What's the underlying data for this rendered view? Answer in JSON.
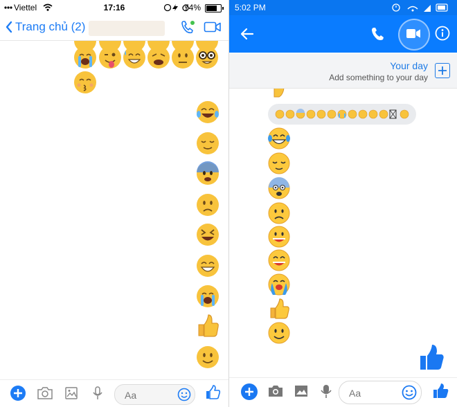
{
  "colors": {
    "messenger_blue": "#0a7cff",
    "ios_blue": "#1d7cf5",
    "emoji_yellow": "#f8c33c",
    "emoji_outline": "#d9962a",
    "bubble_grey": "#e9ebee"
  },
  "ios": {
    "status": {
      "carrier": "Viettel",
      "time": "17:16",
      "battery": "74%",
      "battery_level": 0.74
    },
    "nav": {
      "back_label": "Trang chủ (2)",
      "call_icon": "phone-icon",
      "video_icon": "video-camera-icon"
    },
    "composer": {
      "placeholder": "Aa",
      "icons": [
        "plus-icon",
        "camera-icon",
        "image-icon",
        "mic-icon",
        "emoji-icon",
        "thumbs-up-icon"
      ]
    },
    "received_emojis": [
      "crying-face",
      "winking-tongue-face",
      "grinning-sweat-face",
      "weary-face",
      "neutral-face",
      "nerd-face",
      "kissing-face"
    ],
    "sent_emojis": [
      "tears-of-joy",
      "relieved-face",
      "anxious-face",
      "frowning-face",
      "laughing-face",
      "grinning-face",
      "crying-face",
      "thumbs-up",
      "smiling-face"
    ]
  },
  "android": {
    "status": {
      "time": "5:02 PM"
    },
    "toolbar": {
      "icons": [
        "back-arrow-icon",
        "phone-icon",
        "video-camera-icon",
        "info-icon"
      ]
    },
    "your_day": {
      "title": "Your day",
      "subtitle": "Add something to your day"
    },
    "composer": {
      "placeholder": "Aa",
      "icons": [
        "plus-icon",
        "camera-icon",
        "image-icon",
        "mic-icon",
        "emoji-icon",
        "thumbs-up-icon"
      ]
    },
    "emoji_bubble_count": 13,
    "sent_emojis": [
      "tears-of-joy",
      "relieved-face",
      "anxious-face",
      "frowning-face",
      "laughing-face",
      "grinning-face",
      "crying-face",
      "thumbs-up",
      "smiling-face"
    ]
  }
}
